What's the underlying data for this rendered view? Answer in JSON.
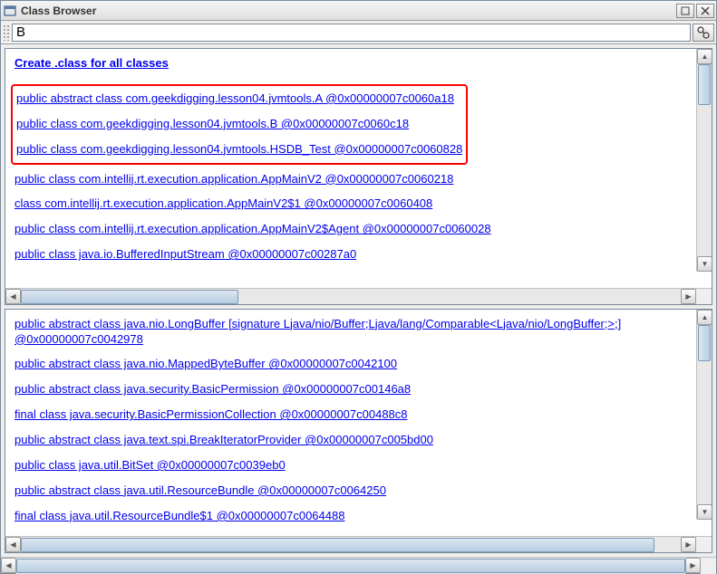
{
  "window": {
    "title": "Class Browser"
  },
  "toolbar": {
    "search_value": "B"
  },
  "pane1": {
    "header_link": "Create .class for all classes",
    "highlighted": [
      "public abstract class com.geekdigging.lesson04.jvmtools.A @0x00000007c0060a18",
      "public class com.geekdigging.lesson04.jvmtools.B @0x00000007c0060c18",
      "public class com.geekdigging.lesson04.jvmtools.HSDB_Test @0x00000007c0060828"
    ],
    "items": [
      "public class com.intellij.rt.execution.application.AppMainV2 @0x00000007c0060218",
      "class com.intellij.rt.execution.application.AppMainV2$1 @0x00000007c0060408",
      "public class com.intellij.rt.execution.application.AppMainV2$Agent @0x00000007c0060028",
      "public class java.io.BufferedInputStream @0x00000007c00287a0"
    ]
  },
  "pane2": {
    "items": [
      "public abstract class java.nio.LongBuffer [signature Ljava/nio/Buffer;Ljava/lang/Comparable<Ljava/nio/LongBuffer;>;] @0x00000007c0042978",
      "public abstract class java.nio.MappedByteBuffer @0x00000007c0042100",
      "public abstract class java.security.BasicPermission @0x00000007c00146a8",
      "final class java.security.BasicPermissionCollection @0x00000007c00488c8",
      "public abstract class java.text.spi.BreakIteratorProvider @0x00000007c005bd00",
      "public class java.util.BitSet @0x00000007c0039eb0",
      "public abstract class java.util.ResourceBundle @0x00000007c0064250",
      "final class java.util.ResourceBundle$1 @0x00000007c0064488"
    ]
  }
}
